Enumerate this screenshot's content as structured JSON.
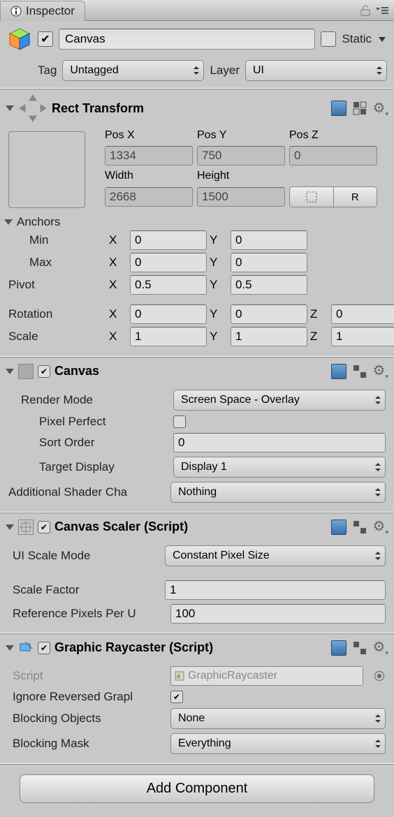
{
  "inspector": {
    "title": "Inspector"
  },
  "header": {
    "enabled": true,
    "name": "Canvas",
    "static_label": "Static",
    "static_checked": false,
    "tag_label": "Tag",
    "tag_value": "Untagged",
    "layer_label": "Layer",
    "layer_value": "UI"
  },
  "rect": {
    "title": "Rect Transform",
    "posx_label": "Pos X",
    "posy_label": "Pos Y",
    "posz_label": "Pos Z",
    "posx": "1334",
    "posy": "750",
    "posz": "0",
    "width_label": "Width",
    "height_label": "Height",
    "width": "2668",
    "height": "1500",
    "blueprint": "⠿",
    "raw": "R",
    "anchors_label": "Anchors",
    "min_label": "Min",
    "max_label": "Max",
    "pivot_label": "Pivot",
    "rotation_label": "Rotation",
    "scale_label": "Scale",
    "x": "X",
    "y": "Y",
    "z": "Z",
    "min_x": "0",
    "min_y": "0",
    "max_x": "0",
    "max_y": "0",
    "pivot_x": "0.5",
    "pivot_y": "0.5",
    "rot_x": "0",
    "rot_y": "0",
    "rot_z": "0",
    "scale_x": "1",
    "scale_y": "1",
    "scale_z": "1"
  },
  "canvas": {
    "title": "Canvas",
    "enabled": true,
    "render_mode_label": "Render Mode",
    "render_mode": "Screen Space - Overlay",
    "pixel_perfect_label": "Pixel Perfect",
    "pixel_perfect": false,
    "sort_order_label": "Sort Order",
    "sort_order": "0",
    "target_display_label": "Target Display",
    "target_display": "Display 1",
    "addl_shader_label": "Additional Shader Cha",
    "addl_shader": "Nothing"
  },
  "scaler": {
    "title": "Canvas Scaler (Script)",
    "enabled": true,
    "mode_label": "UI Scale Mode",
    "mode": "Constant Pixel Size",
    "scale_factor_label": "Scale Factor",
    "scale_factor": "1",
    "ref_ppu_label": "Reference Pixels Per U",
    "ref_ppu": "100"
  },
  "raycaster": {
    "title": "Graphic Raycaster (Script)",
    "enabled": true,
    "script_label": "Script",
    "script": "GraphicRaycaster",
    "ignore_label": "Ignore Reversed Grapl",
    "ignore": true,
    "blocking_objects_label": "Blocking Objects",
    "blocking_objects": "None",
    "blocking_mask_label": "Blocking Mask",
    "blocking_mask": "Everything"
  },
  "footer": {
    "add_component": "Add Component"
  }
}
